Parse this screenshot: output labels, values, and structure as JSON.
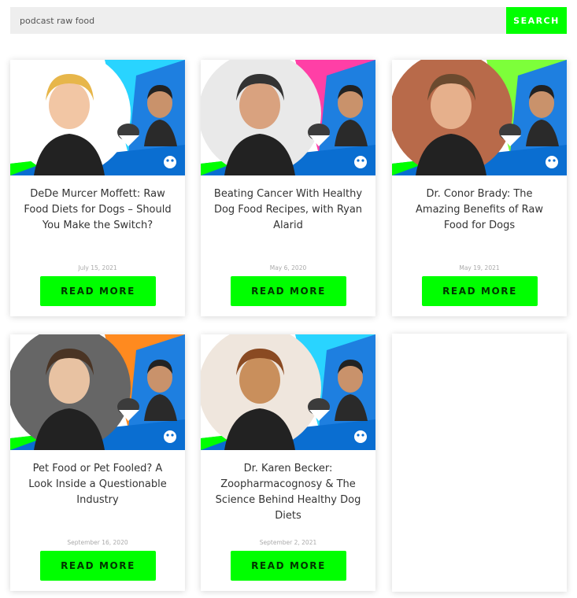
{
  "search": {
    "value": "podcast raw food",
    "button_label": "SEARCH"
  },
  "colors": {
    "accent_green": "#00ff00",
    "brand_blue": "#0a6ed1"
  },
  "posts": [
    {
      "title": "DeDe Murcer Moffett: Raw Food Diets for Dogs – Should You Make the Switch?",
      "date": "July 15, 2021",
      "button_label": "READ MORE",
      "accent_color": "#29d4ff"
    },
    {
      "title": "Beating Cancer With Healthy Dog Food Recipes, with Ryan Alarid",
      "date": "May 6, 2020",
      "button_label": "READ MORE",
      "accent_color": "#ff3fa6"
    },
    {
      "title": "Dr. Conor Brady: The Amazing Benefits of Raw Food for Dogs",
      "date": "May 19, 2021",
      "button_label": "READ MORE",
      "accent_color": "#7dff3a"
    },
    {
      "title": "Pet Food or Pet Fooled? A Look Inside a Questionable Industry",
      "date": "September 16, 2020",
      "button_label": "READ MORE",
      "accent_color": "#ff8a1f"
    },
    {
      "title": "Dr. Karen Becker: Zoopharmacognosy & The Science Behind Healthy Dog Diets",
      "date": "September 2, 2021",
      "button_label": "READ MORE",
      "accent_color": "#29d4ff"
    }
  ]
}
